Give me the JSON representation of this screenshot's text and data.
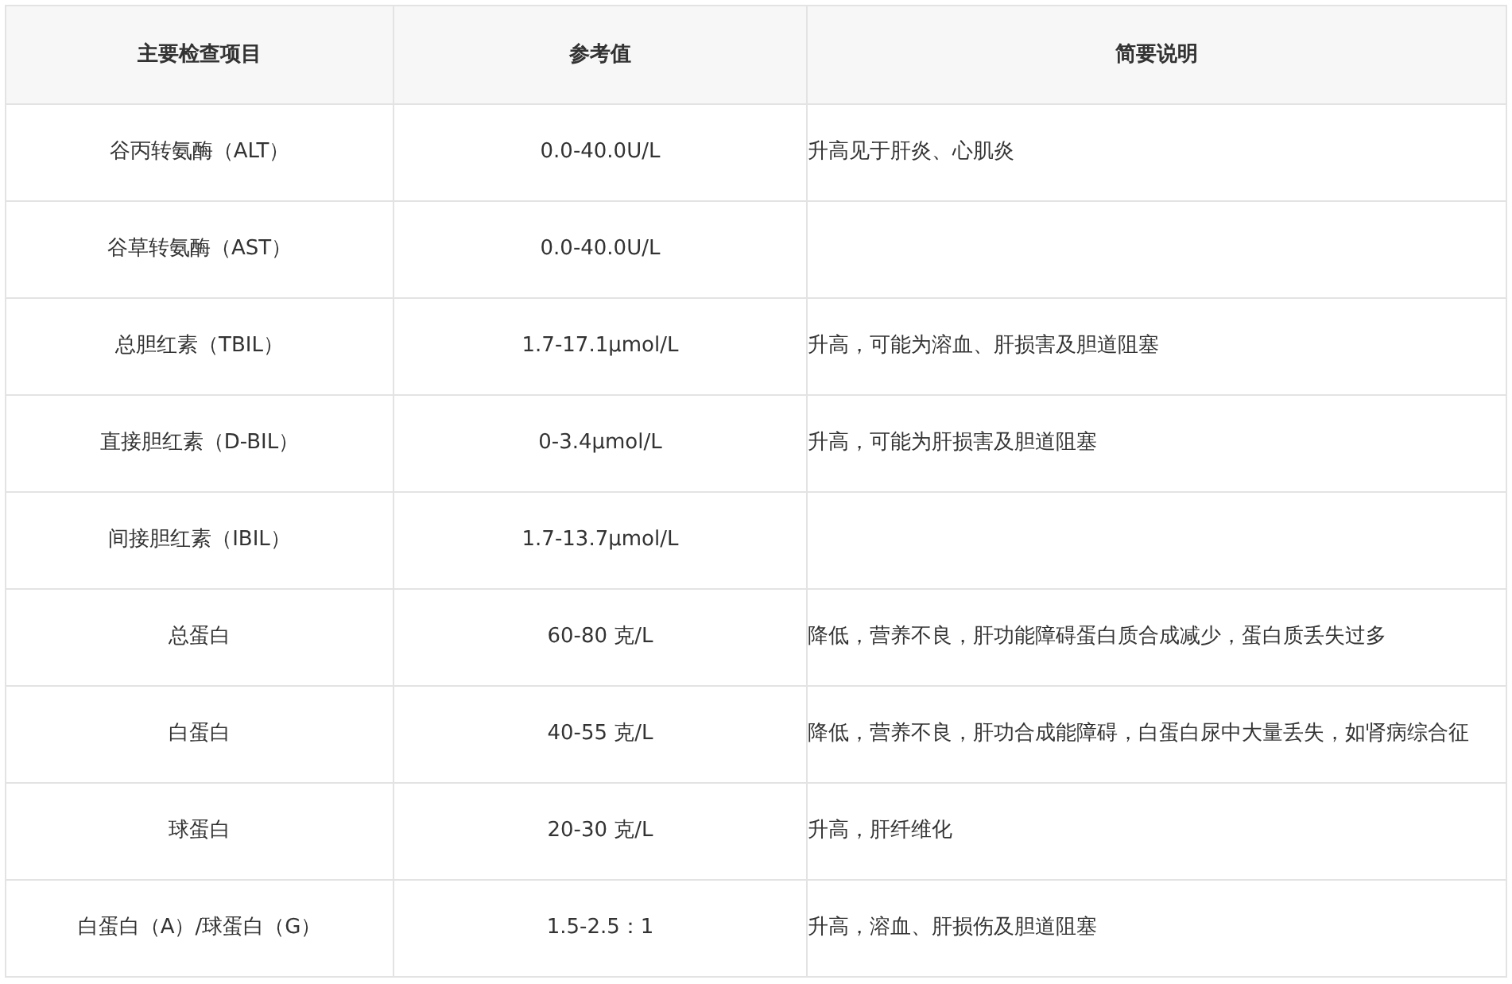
{
  "table": {
    "columns": [
      "主要检查项目",
      "参考值",
      "简要说明"
    ],
    "rows": [
      {
        "item": "谷丙转氨酶（ALT）",
        "reference": "0.0-40.0U/L",
        "note": "升高见于肝炎、心肌炎"
      },
      {
        "item": "谷草转氨酶（AST）",
        "reference": "0.0-40.0U/L"
      },
      {
        "item": "总胆红素（TBIL）",
        "reference": "1.7-17.1μmol/L",
        "note": "升高，可能为溶血、肝损害及胆道阻塞"
      },
      {
        "item": "直接胆红素（D-BIL）",
        "reference": "0-3.4μmol/L",
        "note": "升高，可能为肝损害及胆道阻塞"
      },
      {
        "item": "间接胆红素（IBIL）",
        "reference": "1.7-13.7μmol/L"
      },
      {
        "item": "总蛋白",
        "reference": "60-80 克/L",
        "note": "降低，营养不良，肝功能障碍蛋白质合成减少，蛋白质丢失过多"
      },
      {
        "item": "白蛋白",
        "reference": "40-55 克/L",
        "note": "降低，营养不良，肝功合成能障碍，白蛋白尿中大量丢失，如肾病综合征"
      },
      {
        "item": "球蛋白",
        "reference": "20-30 克/L",
        "note": "升高，肝纤维化"
      },
      {
        "item": "白蛋白（A）/球蛋白（G）",
        "reference": "1.5-2.5：1",
        "note": "升高，溶血、肝损伤及胆道阻塞"
      }
    ]
  }
}
